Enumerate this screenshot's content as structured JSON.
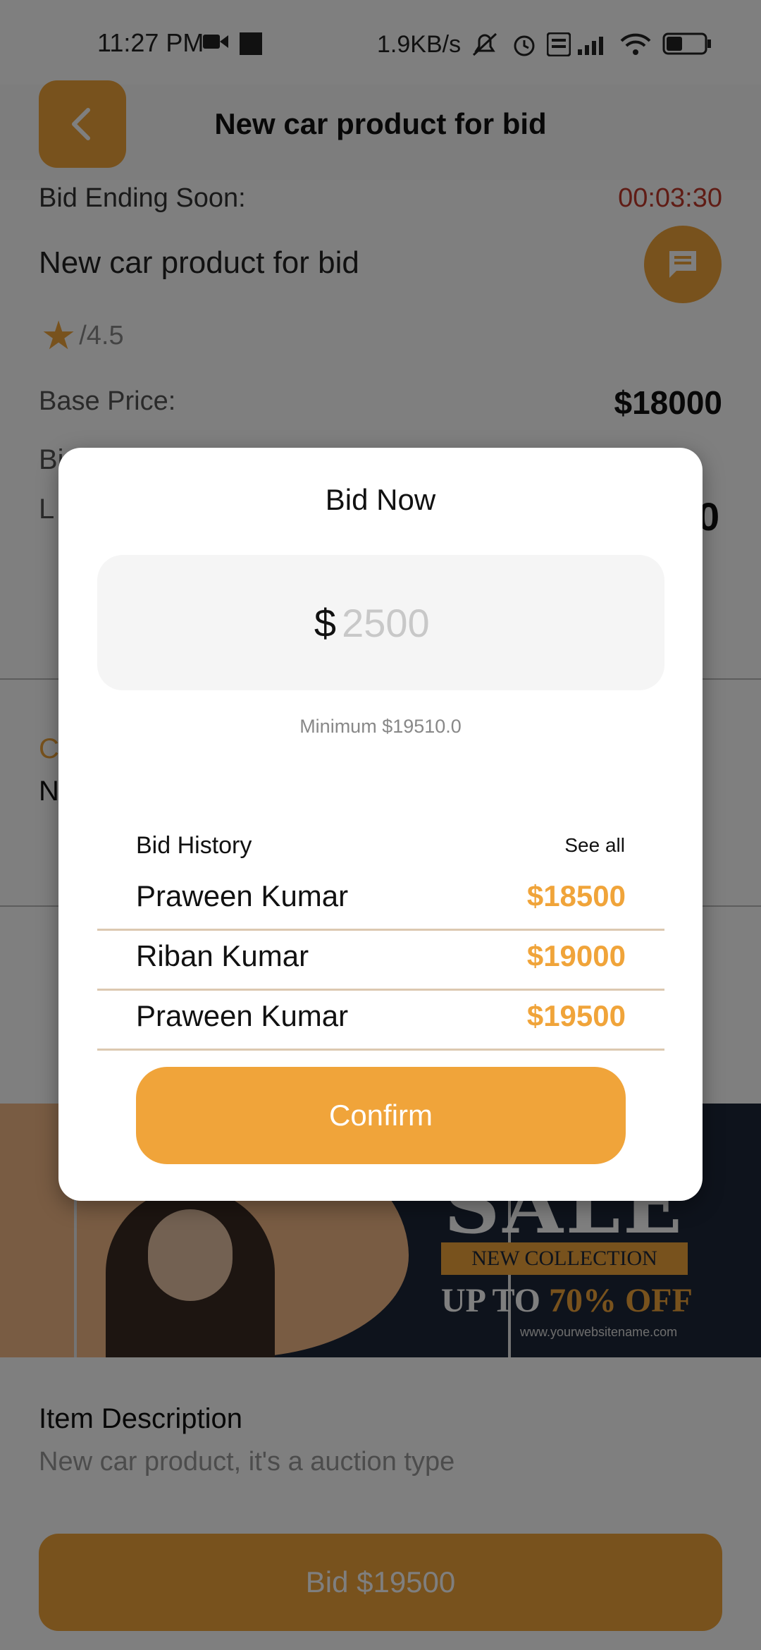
{
  "status_bar": {
    "time": "11:27 PM",
    "net_speed": "1.9KB/s"
  },
  "header": {
    "title": "New car product for bid",
    "back_icon": "chevron-left-icon"
  },
  "product": {
    "bid_ending_label": "Bid Ending Soon:",
    "countdown": "00:03:30",
    "name": "New car product for bid",
    "rating": "/4.5",
    "base_price_label": "Base Price:",
    "base_price": "$18000"
  },
  "banner": {
    "sale": "SALE",
    "new_collection": "NEW COLLECTION",
    "up_to": "UP TO",
    "discount": "70% OFF",
    "website": "www.yourwebsitename.com"
  },
  "description": {
    "title": "Item Description",
    "text": "New car product, it's a auction type"
  },
  "bid_button_label": "Bid $19500",
  "modal": {
    "title": "Bid Now",
    "currency": "$",
    "amount_placeholder": "2500",
    "minimum_text": "Minimum $19510.0",
    "history_title": "Bid History",
    "see_all": "See all",
    "history": [
      {
        "name": "Praween Kumar",
        "amount": "$18500"
      },
      {
        "name": "Riban Kumar",
        "amount": "$19000"
      },
      {
        "name": "Praween Kumar",
        "amount": "$19500"
      }
    ],
    "confirm_label": "Confirm"
  },
  "colors": {
    "accent": "#f0a43a",
    "countdown": "#c0392b",
    "overlay": "rgba(0,0,0,0.5)"
  }
}
